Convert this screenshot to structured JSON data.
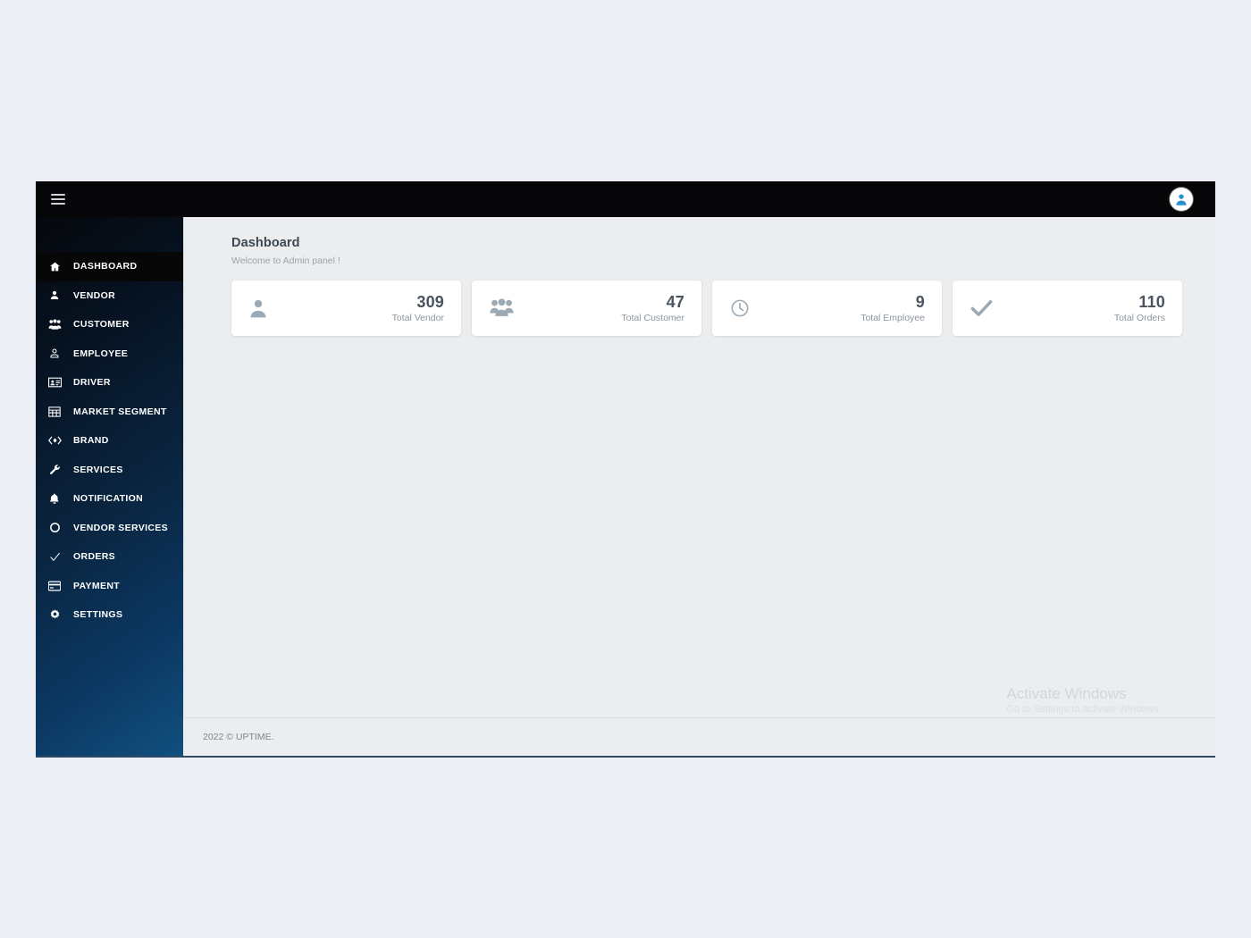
{
  "topbar": {
    "menu_toggle": "hamburger-menu",
    "avatar": "user-avatar"
  },
  "sidebar": {
    "items": [
      {
        "label": "DASHBOARD",
        "icon": "home-icon",
        "active": true
      },
      {
        "label": "VENDOR",
        "icon": "user-icon",
        "active": false
      },
      {
        "label": "CUSTOMER",
        "icon": "customers-icon",
        "active": false
      },
      {
        "label": "EMPLOYEE",
        "icon": "employee-icon",
        "active": false
      },
      {
        "label": "DRIVER",
        "icon": "id-card-icon",
        "active": false
      },
      {
        "label": "MARKET SEGMENT",
        "icon": "table-grid-icon",
        "active": false
      },
      {
        "label": "BRAND",
        "icon": "code-brackets-icon",
        "active": false
      },
      {
        "label": "SERVICES",
        "icon": "wrench-icon",
        "active": false
      },
      {
        "label": "NOTIFICATION",
        "icon": "bell-icon",
        "active": false
      },
      {
        "label": "VENDOR SERVICES",
        "icon": "circle-icon",
        "active": false
      },
      {
        "label": "ORDERS",
        "icon": "check-icon",
        "active": false
      },
      {
        "label": "PAYMENT",
        "icon": "credit-card-icon",
        "active": false
      },
      {
        "label": "SETTINGS",
        "icon": "gear-icon",
        "active": false
      }
    ]
  },
  "page": {
    "title": "Dashboard",
    "subtitle": "Welcome to Admin panel !"
  },
  "cards": [
    {
      "value": "309",
      "label": "Total Vendor",
      "icon": "user-icon"
    },
    {
      "value": "47",
      "label": "Total Customer",
      "icon": "users-group-icon"
    },
    {
      "value": "9",
      "label": "Total Employee",
      "icon": "clock-icon"
    },
    {
      "value": "110",
      "label": "Total Orders",
      "icon": "check-icon"
    }
  ],
  "watermark": {
    "title": "Activate Windows",
    "subtitle": "Go to Settings to activate Windows."
  },
  "footer": {
    "copyright": "2022 © UPTIME."
  },
  "colors": {
    "sidebar_top": "#05070c",
    "sidebar_bottom": "#11507f",
    "topbar": "#060608",
    "content_bg": "#ebedee",
    "card_bg": "#ffffff",
    "accent_blue": "#2b8fd1",
    "desktop_bg": "#eceef6"
  }
}
